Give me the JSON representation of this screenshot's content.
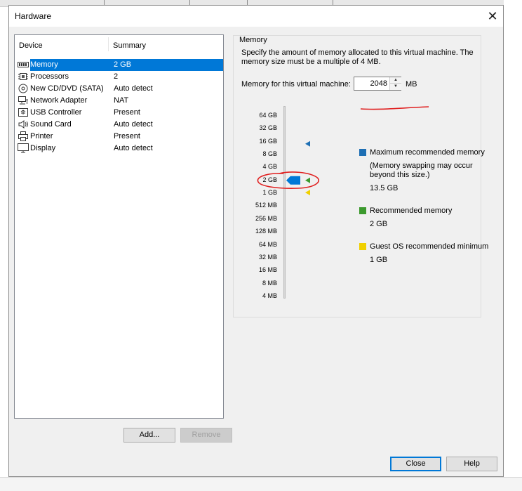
{
  "dialog": {
    "title": "Hardware"
  },
  "devices": {
    "headers": {
      "device": "Device",
      "summary": "Summary"
    },
    "rows": [
      {
        "name": "Memory",
        "summary": "2 GB",
        "icon": "memory-icon",
        "selected": true
      },
      {
        "name": "Processors",
        "summary": "2",
        "icon": "processor-icon"
      },
      {
        "name": "New CD/DVD (SATA)",
        "summary": "Auto detect",
        "icon": "cd-dvd-icon"
      },
      {
        "name": "Network Adapter",
        "summary": "NAT",
        "icon": "network-adapter-icon"
      },
      {
        "name": "USB Controller",
        "summary": "Present",
        "icon": "usb-controller-icon"
      },
      {
        "name": "Sound Card",
        "summary": "Auto detect",
        "icon": "sound-card-icon"
      },
      {
        "name": "Printer",
        "summary": "Present",
        "icon": "printer-icon"
      },
      {
        "name": "Display",
        "summary": "Auto detect",
        "icon": "display-icon"
      }
    ]
  },
  "buttons": {
    "add": "Add...",
    "remove": "Remove",
    "close": "Close",
    "help": "Help"
  },
  "memory": {
    "group_label": "Memory",
    "description": "Specify the amount of memory allocated to this virtual machine. The memory size must be a multiple of 4 MB.",
    "field_label": "Memory for this virtual machine:",
    "value": "2048",
    "unit": "MB",
    "scale_labels": [
      "64 GB",
      "32 GB",
      "16 GB",
      "8 GB",
      "4 GB",
      "2 GB",
      "1 GB",
      "512 MB",
      "256 MB",
      "128 MB",
      "64 MB",
      "32 MB",
      "16 MB",
      "8 MB",
      "4 MB"
    ],
    "current_level": "2 GB",
    "markers": {
      "maximum": "16 GB",
      "recommended": "2 GB",
      "guest_minimum": "1 GB"
    },
    "legend": {
      "maximum": {
        "title": "Maximum recommended memory",
        "note": "(Memory swapping may occur beyond this size.)",
        "value": "13.5 GB",
        "color": "#1e6fb4"
      },
      "recommended": {
        "title": "Recommended memory",
        "value": "2 GB",
        "color": "#3c9a2e"
      },
      "guest_min": {
        "title": "Guest OS recommended minimum",
        "value": "1 GB",
        "color": "#f0d000"
      }
    }
  },
  "colors": {
    "selection": "#0078d7",
    "annotation": "#e02020"
  }
}
